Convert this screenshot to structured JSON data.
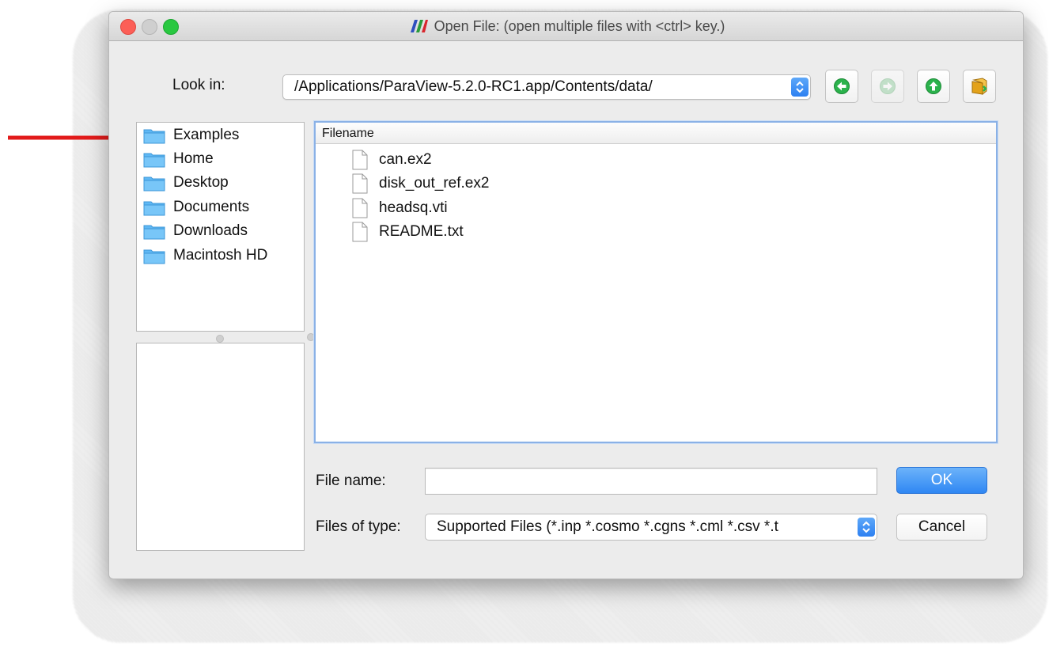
{
  "window": {
    "title": "Open File:  (open multiple files with <ctrl> key.)"
  },
  "look_in": {
    "label": "Look in:",
    "path": "/Applications/ParaView-5.2.0-RC1.app/Contents/data/"
  },
  "nav_buttons": [
    {
      "name": "back",
      "icon": "back-arrow-icon",
      "enabled": true
    },
    {
      "name": "forward",
      "icon": "forward-arrow-icon",
      "enabled": false
    },
    {
      "name": "up",
      "icon": "up-arrow-icon",
      "enabled": true
    },
    {
      "name": "new-folder",
      "icon": "new-folder-icon",
      "enabled": true
    }
  ],
  "places": [
    {
      "label": "Examples"
    },
    {
      "label": "Home"
    },
    {
      "label": "Desktop"
    },
    {
      "label": "Documents"
    },
    {
      "label": "Downloads"
    },
    {
      "label": "Macintosh HD"
    }
  ],
  "file_list": {
    "column_header": "Filename",
    "files": [
      {
        "name": "can.ex2"
      },
      {
        "name": "disk_out_ref.ex2"
      },
      {
        "name": "headsq.vti"
      },
      {
        "name": "README.txt"
      }
    ]
  },
  "file_name": {
    "label": "File name:",
    "value": ""
  },
  "file_type": {
    "label": "Files of type:",
    "value": "Supported Files (*.inp  *.cosmo  *.cgns  *.cml  *.csv *.t"
  },
  "buttons": {
    "ok": "OK",
    "cancel": "Cancel"
  },
  "colors": {
    "accent": "#2f87f3",
    "annotation_arrow": "#e21b1b",
    "folder": "#5fb8f5",
    "nav_green": "#2bb24c"
  }
}
